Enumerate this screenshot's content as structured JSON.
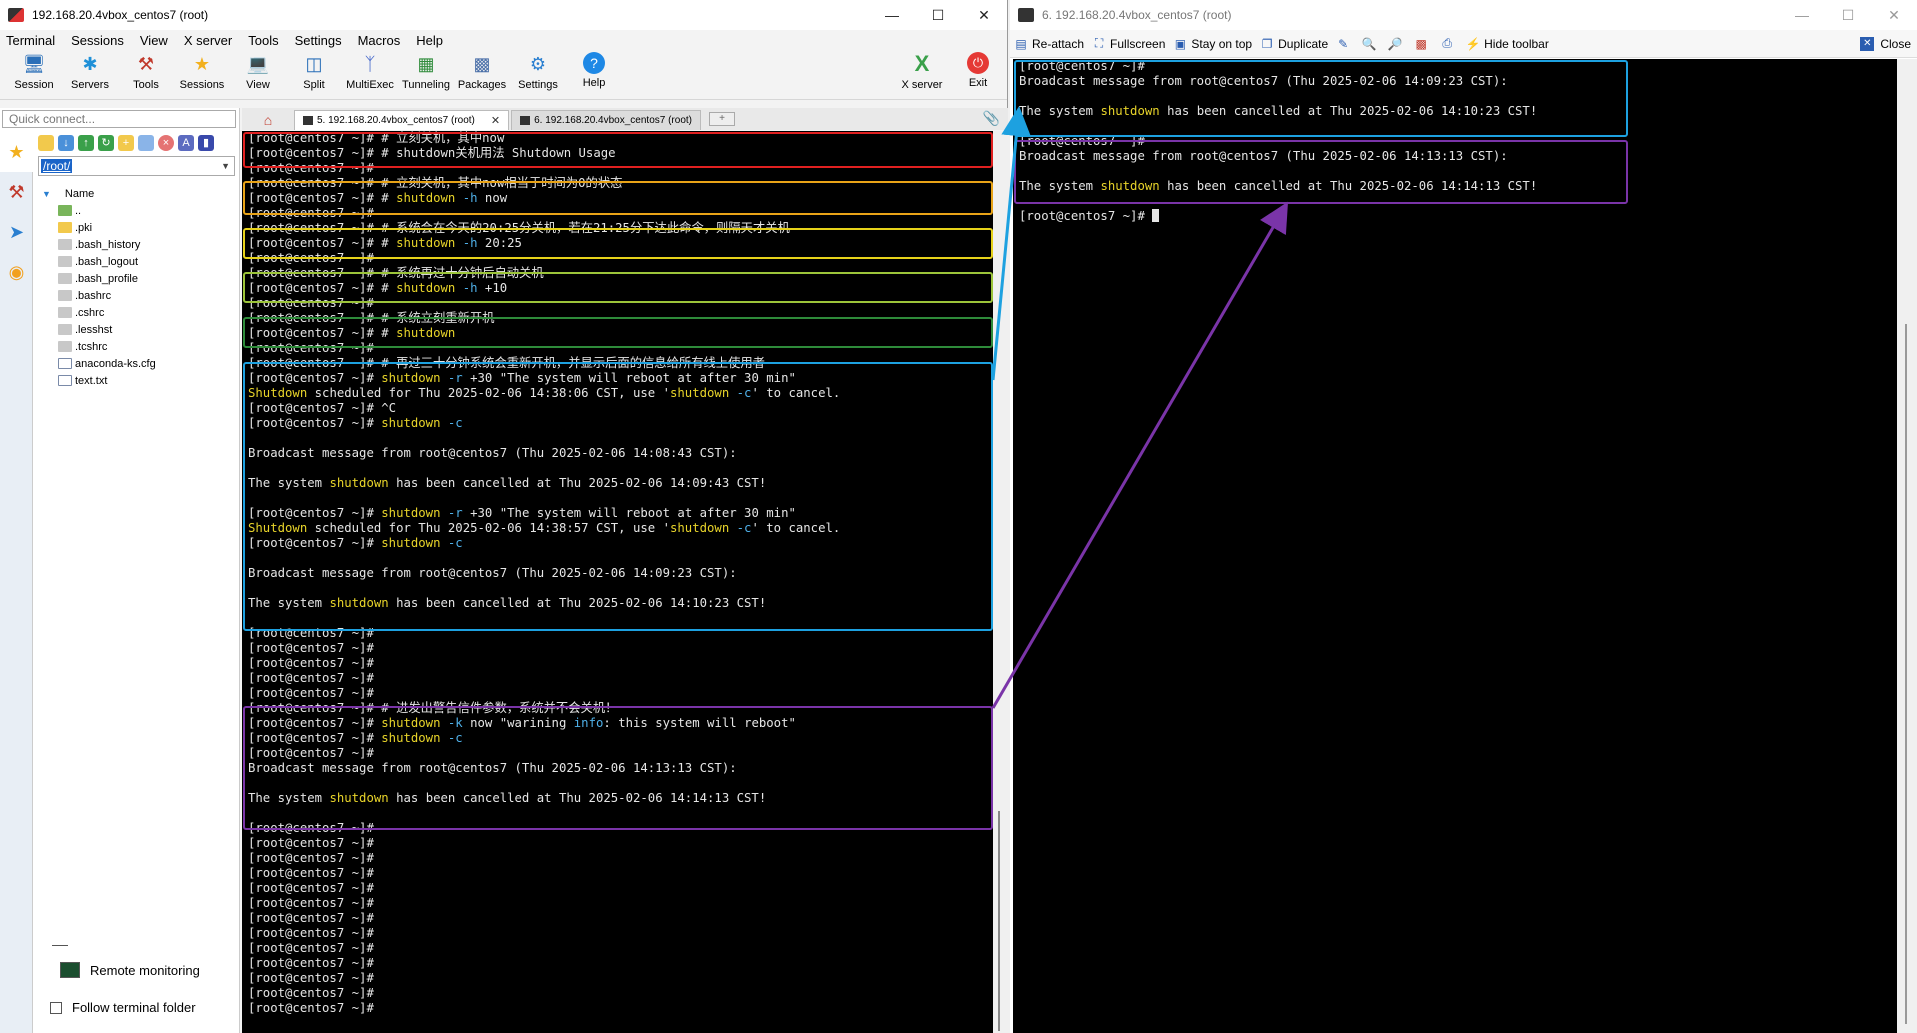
{
  "left_window": {
    "title": "192.168.20.4vbox_centos7 (root)",
    "menu": [
      "Terminal",
      "Sessions",
      "View",
      "X server",
      "Tools",
      "Settings",
      "Macros",
      "Help"
    ],
    "toolbar": [
      "Session",
      "Servers",
      "Tools",
      "Sessions",
      "View",
      "Split",
      "MultiExec",
      "Tunneling",
      "Packages",
      "Settings",
      "Help"
    ],
    "toolbar_right": [
      "X server",
      "Exit"
    ],
    "quick_connect_placeholder": "Quick connect...",
    "path": "/root/",
    "file_column": "Name",
    "files": [
      "..",
      ".pki",
      ".bash_history",
      ".bash_logout",
      ".bash_profile",
      ".bashrc",
      ".cshrc",
      ".lesshst",
      ".tcshrc",
      "anaconda-ks.cfg",
      "text.txt"
    ],
    "remote_monitoring": "Remote monitoring",
    "follow_terminal": "Follow terminal folder",
    "tabs": [
      "5. 192.168.20.4vbox_centos7 (root)",
      "6. 192.168.20.4vbox_centos7 (root)"
    ]
  },
  "right_window": {
    "title": "6. 192.168.20.4vbox_centos7 (root)",
    "toolbar": [
      "Re-attach",
      "Fullscreen",
      "Stay on top",
      "Duplicate",
      "Hide toolbar"
    ],
    "close": "Close"
  },
  "terminal_left": [
    [
      [
        "p",
        "[root@centos7 ~]# "
      ],
      [
        "t",
        "# 立刻关机，其中now"
      ]
    ],
    [
      [
        "p",
        "[root@centos7 ~]# "
      ],
      [
        "t",
        "# shutdown关机用法 Shutdown Usage"
      ]
    ],
    [
      [
        "p",
        "[root@centos7 ~]#"
      ]
    ],
    [
      [
        "p",
        "[root@centos7 ~]# "
      ],
      [
        "t",
        "# 立刻关机，其中now相当于时间为0的状态"
      ]
    ],
    [
      [
        "p",
        "[root@centos7 ~]# "
      ],
      [
        "t",
        "# "
      ],
      [
        "k",
        "shutdown"
      ],
      [
        "o",
        " -h"
      ],
      [
        "t",
        " now"
      ]
    ],
    [
      [
        "p",
        "[root@centos7 ~]#"
      ]
    ],
    [
      [
        "p",
        "[root@centos7 ~]# "
      ],
      [
        "t",
        "# 系统会在今天的20:25分关机，若在21:25分下达此命令，则隔天才关机"
      ]
    ],
    [
      [
        "p",
        "[root@centos7 ~]# "
      ],
      [
        "t",
        "# "
      ],
      [
        "k",
        "shutdown"
      ],
      [
        "o",
        " -h"
      ],
      [
        "t",
        " 20:25"
      ]
    ],
    [
      [
        "p",
        "[root@centos7 ~]#"
      ]
    ],
    [
      [
        "p",
        "[root@centos7 ~]# "
      ],
      [
        "t",
        "# 系统再过十分钟后自动关机"
      ]
    ],
    [
      [
        "p",
        "[root@centos7 ~]# "
      ],
      [
        "t",
        "# "
      ],
      [
        "k",
        "shutdown"
      ],
      [
        "o",
        " -h"
      ],
      [
        "t",
        " +10"
      ]
    ],
    [
      [
        "p",
        "[root@centos7 ~]#"
      ]
    ],
    [
      [
        "p",
        "[root@centos7 ~]# "
      ],
      [
        "t",
        "# 系统立刻重新开机"
      ]
    ],
    [
      [
        "p",
        "[root@centos7 ~]# "
      ],
      [
        "t",
        "# "
      ],
      [
        "k",
        "shutdown"
      ]
    ],
    [
      [
        "p",
        "[root@centos7 ~]#"
      ]
    ],
    [
      [
        "p",
        "[root@centos7 ~]# "
      ],
      [
        "t",
        "# 再过三十分钟系统会重新开机，并显示后面的信息给所有线上使用者"
      ]
    ],
    [
      [
        "p",
        "[root@centos7 ~]# "
      ],
      [
        "k",
        "shutdown"
      ],
      [
        "o",
        " -r"
      ],
      [
        "t",
        " +30 \"The system will reboot at after 30 min\""
      ]
    ],
    [
      [
        "k",
        "Shutdown"
      ],
      [
        "t",
        " scheduled for Thu 2025-02-06 14:38:06 CST, use '"
      ],
      [
        "k",
        "shutdown"
      ],
      [
        "o",
        " -c"
      ],
      [
        "t",
        "' to cancel."
      ]
    ],
    [
      [
        "p",
        "[root@centos7 ~]# "
      ],
      [
        "t",
        "^C"
      ]
    ],
    [
      [
        "p",
        "[root@centos7 ~]# "
      ],
      [
        "k",
        "shutdown"
      ],
      [
        "o",
        " -c"
      ]
    ],
    [
      [
        "t",
        ""
      ]
    ],
    [
      [
        "t",
        "Broadcast message from root@centos7 (Thu 2025-02-06 14:08:43 CST):"
      ]
    ],
    [
      [
        "t",
        ""
      ]
    ],
    [
      [
        "t",
        "The system "
      ],
      [
        "k",
        "shutdown"
      ],
      [
        "t",
        " has been cancelled at Thu 2025-02-06 14:09:43 CST!"
      ]
    ],
    [
      [
        "t",
        ""
      ]
    ],
    [
      [
        "p",
        "[root@centos7 ~]# "
      ],
      [
        "k",
        "shutdown"
      ],
      [
        "o",
        " -r"
      ],
      [
        "t",
        " +30 \"The system will reboot at after 30 min\""
      ]
    ],
    [
      [
        "k",
        "Shutdown"
      ],
      [
        "t",
        " scheduled for Thu 2025-02-06 14:38:57 CST, use '"
      ],
      [
        "k",
        "shutdown"
      ],
      [
        "o",
        " -c"
      ],
      [
        "t",
        "' to cancel."
      ]
    ],
    [
      [
        "p",
        "[root@centos7 ~]# "
      ],
      [
        "k",
        "shutdown"
      ],
      [
        "o",
        " -c"
      ]
    ],
    [
      [
        "t",
        ""
      ]
    ],
    [
      [
        "t",
        "Broadcast message from root@centos7 (Thu 2025-02-06 14:09:23 CST):"
      ]
    ],
    [
      [
        "t",
        ""
      ]
    ],
    [
      [
        "t",
        "The system "
      ],
      [
        "k",
        "shutdown"
      ],
      [
        "t",
        " has been cancelled at Thu 2025-02-06 14:10:23 CST!"
      ]
    ],
    [
      [
        "t",
        ""
      ]
    ],
    [
      [
        "p",
        "[root@centos7 ~]#"
      ]
    ],
    [
      [
        "p",
        "[root@centos7 ~]#"
      ]
    ],
    [
      [
        "p",
        "[root@centos7 ~]#"
      ]
    ],
    [
      [
        "p",
        "[root@centos7 ~]#"
      ]
    ],
    [
      [
        "p",
        "[root@centos7 ~]#"
      ]
    ],
    [
      [
        "p",
        "[root@centos7 ~]# "
      ],
      [
        "t",
        "# 进发出警告信件参数，系统并不会关机！"
      ]
    ],
    [
      [
        "p",
        "[root@centos7 ~]# "
      ],
      [
        "k",
        "shutdown"
      ],
      [
        "o",
        " -k"
      ],
      [
        "t",
        " now \"warining "
      ],
      [
        "o",
        "info"
      ],
      [
        "t",
        ": this system will reboot\""
      ]
    ],
    [
      [
        "p",
        "[root@centos7 ~]# "
      ],
      [
        "k",
        "shutdown"
      ],
      [
        "o",
        " -c"
      ]
    ],
    [
      [
        "p",
        "[root@centos7 ~]#"
      ]
    ],
    [
      [
        "t",
        "Broadcast message from root@centos7 (Thu 2025-02-06 14:13:13 CST):"
      ]
    ],
    [
      [
        "t",
        ""
      ]
    ],
    [
      [
        "t",
        "The system "
      ],
      [
        "k",
        "shutdown"
      ],
      [
        "t",
        " has been cancelled at Thu 2025-02-06 14:14:13 CST!"
      ]
    ],
    [
      [
        "t",
        ""
      ]
    ],
    [
      [
        "p",
        "[root@centos7 ~]#"
      ]
    ],
    [
      [
        "p",
        "[root@centos7 ~]#"
      ]
    ],
    [
      [
        "p",
        "[root@centos7 ~]#"
      ]
    ],
    [
      [
        "p",
        "[root@centos7 ~]#"
      ]
    ],
    [
      [
        "p",
        "[root@centos7 ~]#"
      ]
    ],
    [
      [
        "p",
        "[root@centos7 ~]#"
      ]
    ],
    [
      [
        "p",
        "[root@centos7 ~]#"
      ]
    ],
    [
      [
        "p",
        "[root@centos7 ~]#"
      ]
    ],
    [
      [
        "p",
        "[root@centos7 ~]#"
      ]
    ],
    [
      [
        "p",
        "[root@centos7 ~]#"
      ]
    ],
    [
      [
        "p",
        "[root@centos7 ~]#"
      ]
    ],
    [
      [
        "p",
        "[root@centos7 ~]#"
      ]
    ],
    [
      [
        "p",
        "[root@centos7 ~]#"
      ]
    ]
  ],
  "terminal_right": [
    [
      [
        "p",
        "[root@centos7 ~]#"
      ]
    ],
    [
      [
        "t",
        "Broadcast message from root@centos7 (Thu 2025-02-06 14:09:23 CST):"
      ]
    ],
    [
      [
        "t",
        ""
      ]
    ],
    [
      [
        "t",
        "The system "
      ],
      [
        "k",
        "shutdown"
      ],
      [
        "t",
        " has been cancelled at Thu 2025-02-06 14:10:23 CST!"
      ]
    ],
    [
      [
        "t",
        ""
      ]
    ],
    [
      [
        "p",
        "[root@centos7 ~]#"
      ]
    ],
    [
      [
        "t",
        "Broadcast message from root@centos7 (Thu 2025-02-06 14:13:13 CST):"
      ]
    ],
    [
      [
        "t",
        ""
      ]
    ],
    [
      [
        "t",
        "The system "
      ],
      [
        "k",
        "shutdown"
      ],
      [
        "t",
        " has been cancelled at Thu 2025-02-06 14:14:13 CST!"
      ]
    ],
    [
      [
        "t",
        ""
      ]
    ],
    [
      [
        "p",
        "[root@centos7 ~]# "
      ],
      [
        "c",
        ""
      ]
    ]
  ],
  "colors": {
    "keyword": "#e8d42a",
    "option": "#4fb0e8",
    "box_red": "#e02020",
    "box_orange": "#e8a317",
    "box_yellow": "#e6d21a",
    "box_lime": "#9cc43a",
    "box_green": "#2e8b3a",
    "box_blue": "#1da1e0",
    "box_purple": "#7a34a8"
  }
}
